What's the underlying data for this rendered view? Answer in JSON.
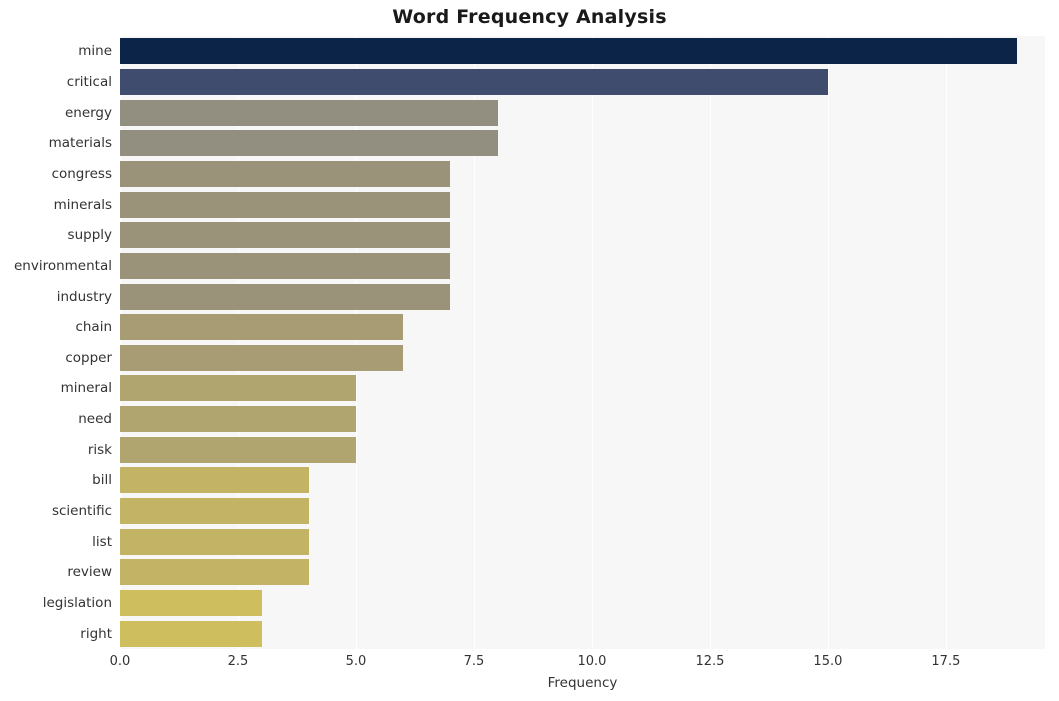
{
  "chart_data": {
    "type": "bar",
    "orientation": "horizontal",
    "title": "Word Frequency Analysis",
    "xlabel": "Frequency",
    "ylabel": "",
    "xlim": [
      0,
      19.6
    ],
    "xticks": [
      0.0,
      2.5,
      5.0,
      7.5,
      10.0,
      12.5,
      15.0,
      17.5
    ],
    "xtick_labels": [
      "0.0",
      "2.5",
      "5.0",
      "7.5",
      "10.0",
      "12.5",
      "15.0",
      "17.5"
    ],
    "grid": "vertical",
    "legend": "none",
    "categories": [
      "mine",
      "critical",
      "energy",
      "materials",
      "congress",
      "minerals",
      "supply",
      "environmental",
      "industry",
      "chain",
      "copper",
      "mineral",
      "need",
      "risk",
      "bill",
      "scientific",
      "list",
      "review",
      "legislation",
      "right"
    ],
    "values": [
      19,
      15,
      8,
      8,
      7,
      7,
      7,
      7,
      7,
      6,
      6,
      5,
      5,
      5,
      4,
      4,
      4,
      4,
      3,
      3
    ],
    "bar_colors": [
      "#0b2447",
      "#404c6e",
      "#938f80",
      "#938f80",
      "#9b9379",
      "#9b9379",
      "#9b9379",
      "#9b9379",
      "#9b9379",
      "#a79c74",
      "#a79c74",
      "#b0a46f",
      "#b0a46f",
      "#b0a46f",
      "#c2b464",
      "#c2b464",
      "#c2b464",
      "#c2b464",
      "#cfbe5d",
      "#cfbe5d"
    ],
    "plot_background": "#f7f7f7",
    "grid_color": "#ffffff",
    "figure_background": "#ffffff"
  }
}
